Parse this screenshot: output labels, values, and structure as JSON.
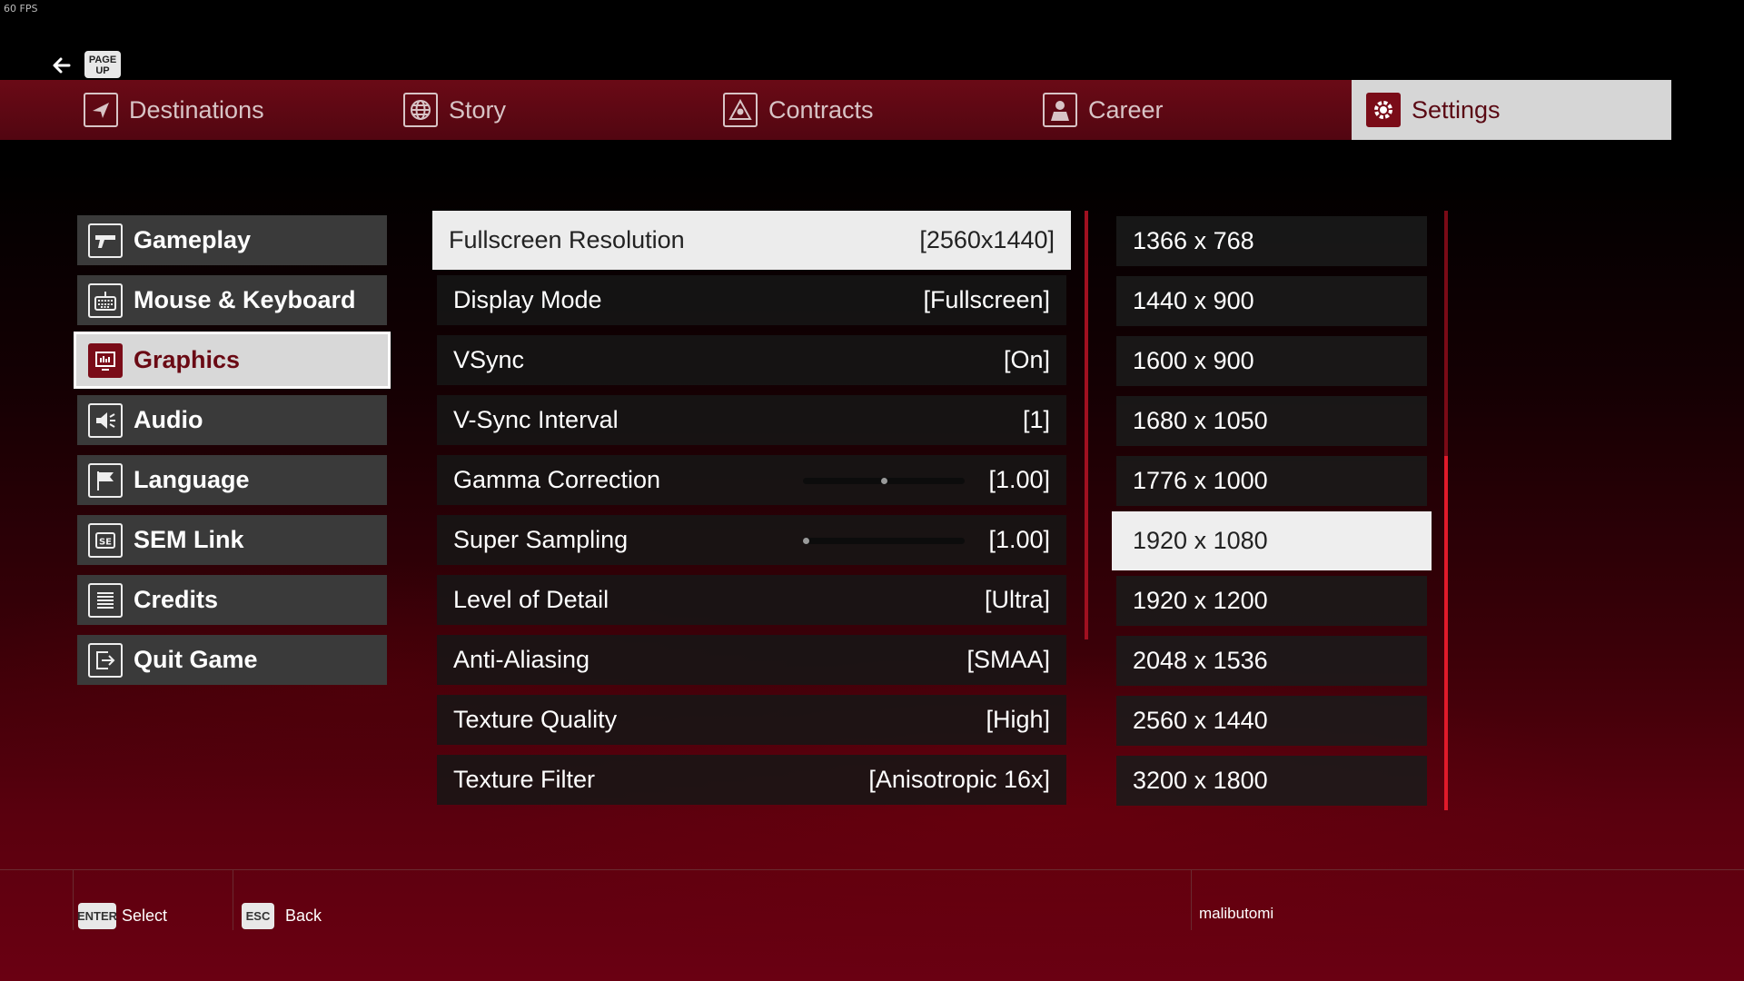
{
  "fps": "60 FPS",
  "nav": {
    "page_up_key": "PAGE UP",
    "tabs": [
      {
        "label": "Destinations",
        "icon": "plane-icon"
      },
      {
        "label": "Story",
        "icon": "globe-icon"
      },
      {
        "label": "Contracts",
        "icon": "skull-warning-icon"
      },
      {
        "label": "Career",
        "icon": "agent-icon"
      },
      {
        "label": "Settings",
        "icon": "gear-icon",
        "active": true
      }
    ]
  },
  "menu": {
    "items": [
      {
        "label": "Gameplay",
        "icon": "pistol-icon"
      },
      {
        "label": "Mouse & Keyboard",
        "icon": "keyboard-icon"
      },
      {
        "label": "Graphics",
        "icon": "monitor-icon",
        "active": true
      },
      {
        "label": "Audio",
        "icon": "speaker-icon"
      },
      {
        "label": "Language",
        "icon": "flag-icon"
      },
      {
        "label": "SEM Link",
        "icon": "se-icon"
      },
      {
        "label": "Credits",
        "icon": "list-icon"
      },
      {
        "label": "Quit Game",
        "icon": "exit-icon"
      }
    ]
  },
  "settings": {
    "rows": [
      {
        "label": "Fullscreen Resolution",
        "value": "[2560x1440]"
      },
      {
        "label": "Display Mode",
        "value": "[Fullscreen]"
      },
      {
        "label": "VSync",
        "value": "[On]"
      },
      {
        "label": "V-Sync Interval",
        "value": "[1]"
      },
      {
        "label": "Gamma Correction",
        "value": "[1.00]",
        "slider_level": 0.5
      },
      {
        "label": "Super Sampling",
        "value": "[1.00]",
        "slider_level": 0.0
      },
      {
        "label": "Level of Detail",
        "value": "[Ultra]"
      },
      {
        "label": "Anti-Aliasing",
        "value": "[SMAA]"
      },
      {
        "label": "Texture Quality",
        "value": "[High]"
      },
      {
        "label": "Texture Filter",
        "value": "[Anisotropic 16x]"
      }
    ]
  },
  "resolutions": {
    "items": [
      "1366 x 768",
      "1440 x 900",
      "1600 x 900",
      "1680 x 1050",
      "1776 x 1000",
      "1920 x 1080",
      "1920 x 1200",
      "2048 x 1536",
      "2560 x 1440",
      "3200 x 1800"
    ],
    "selected": "1920 x 1080"
  },
  "footer": {
    "select_key": "ENTER",
    "select_label": "Select",
    "back_key": "ESC",
    "back_label": "Back",
    "username": "malibutomi"
  },
  "colors": {
    "accent": "#7a0c18",
    "scroll": "#e01a2a"
  }
}
